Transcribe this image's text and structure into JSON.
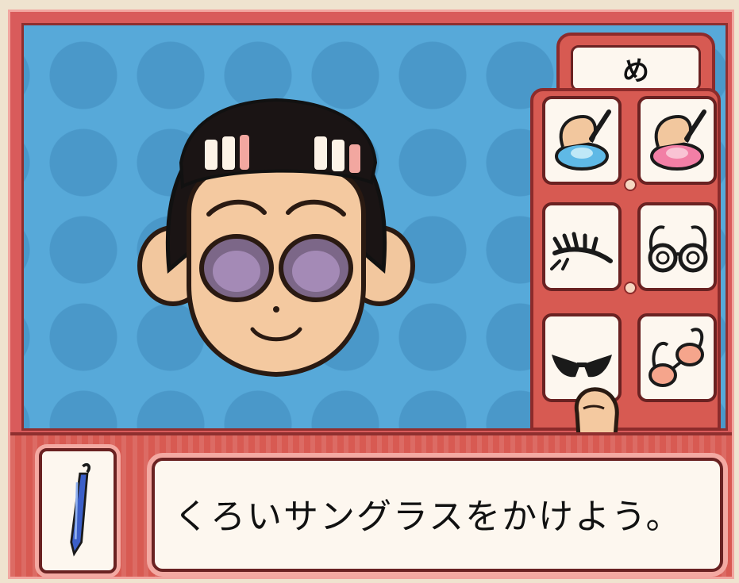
{
  "category_tab": {
    "label": "め"
  },
  "item_grid": {
    "items": [
      {
        "name": "blue-eye-color-palette-icon",
        "selected": false
      },
      {
        "name": "pink-eye-color-palette-icon",
        "selected": false
      },
      {
        "name": "eyelashes-icon",
        "selected": false
      },
      {
        "name": "round-glasses-icon",
        "selected": false
      },
      {
        "name": "black-sunglasses-icon",
        "selected": true
      },
      {
        "name": "pink-glasses-icon",
        "selected": false
      }
    ]
  },
  "tool": {
    "icon": "blue-pen-icon"
  },
  "message": {
    "text": "くろいサングラスをかけよう。"
  },
  "colors": {
    "field": "#57a9d9",
    "frame": "#d95b5b",
    "outline": "#6a2222",
    "panel_fill": "#fdf7ef"
  }
}
